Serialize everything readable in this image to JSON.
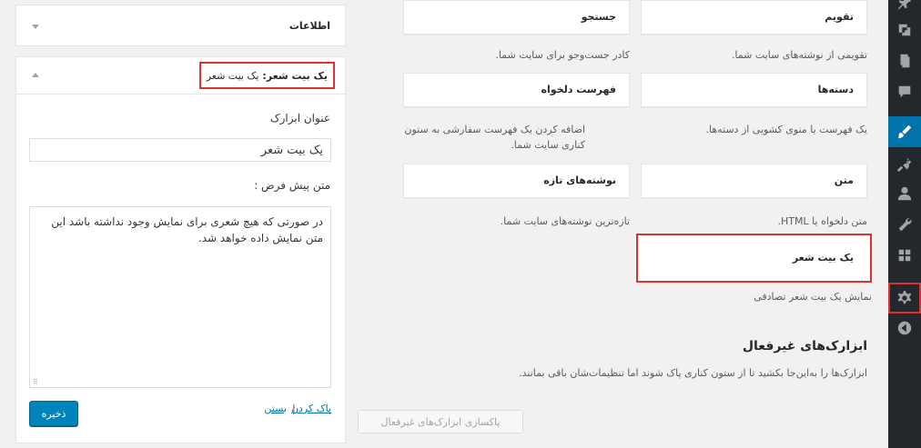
{
  "left_panel": {
    "info_area": {
      "title": "اطلاعات"
    },
    "widget_editor": {
      "header_name": "یک بیت شعر:",
      "header_instance": "یک بیت شعر",
      "title_label": "عنوان ابزارک",
      "title_value": "یک بیت شعر",
      "default_text_label": "متن پیش فرض :",
      "default_text_value": "در صورتی که هیچ شعری برای نمایش وجود نداشته باشد این متن نمایش داده خواهد شد.",
      "save_label": "ذخیره",
      "delete_label": "پاک کردن",
      "separator": "|",
      "close_label": "بستن"
    }
  },
  "available_widgets": [
    {
      "title": "تقویم",
      "description": "تقویمی از نوشته‌های سایت شما."
    },
    {
      "title": "جستجو",
      "description": "کادر جست‌وجو برای سایت شما."
    },
    {
      "title": "دسته‌ها",
      "description": "یک فهرست یا منوی کشویی از دسته‌ها."
    },
    {
      "title": "فهرست دلخواه",
      "description": "اضافه کردن یک فهرست سفارشی به ستون کناری سایت شما."
    },
    {
      "title": "متن",
      "description": "متن دلخواه یا HTML."
    },
    {
      "title": "نوشته‌های تازه",
      "description": "تازه‌ترین نوشته‌های سایت شما."
    },
    {
      "title": "یک بیت شعر",
      "description": "نمایش یک بیت شعر تصادفی"
    }
  ],
  "inactive_widgets": {
    "title": "ابزارک‌های غیرفعال",
    "description": "ابزارک‌ها را به‌این‌جا بکشید تا از ستون کناری پاک شوند اما تنظیمات‌شان باقی بمانند.",
    "clear_label": "پاکسازی ابزارک‌های غیرفعال"
  },
  "colors": {
    "accent": "#0073aa",
    "highlight": "#dc3232",
    "sidebar": "#23282d",
    "primary_button": "#0085ba"
  },
  "sidebar_icons": [
    "pin-icon",
    "media-icon",
    "pages-icon",
    "comments-icon",
    "appearance-brush-icon",
    "plugins-icon",
    "users-icon",
    "tools-wrench-icon",
    "widgets-icon",
    "settings-gear-icon",
    "collapse-menu-icon"
  ]
}
